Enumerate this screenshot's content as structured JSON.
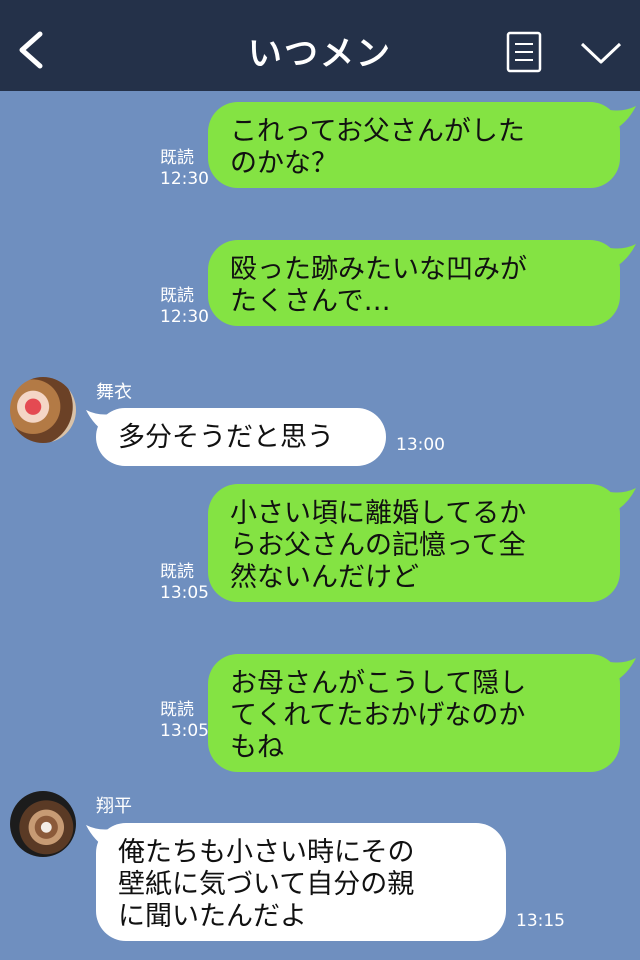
{
  "header": {
    "title": "いつメン"
  },
  "messages": [
    {
      "from": "me",
      "text": "これってお父さんがした\nのかな？",
      "read": "既読",
      "time": "12:30"
    },
    {
      "from": "me",
      "text": "殴った跡みたいな凹みが\nたくさんで…",
      "read": "既読",
      "time": "12:30"
    },
    {
      "from": "other",
      "sender": "舞衣",
      "text": "多分そうだと思う",
      "time": "13:00"
    },
    {
      "from": "me",
      "text": "小さい頃に離婚してるか\nらお父さんの記憶って全\n然ないんだけど",
      "read": "既読",
      "time": "13:05"
    },
    {
      "from": "me",
      "text": "お母さんがこうして隠し\nてくれてたおかげなのか\nもね",
      "read": "既読",
      "time": "13:05"
    },
    {
      "from": "other",
      "sender": "翔平",
      "text": "俺たちも小さい時にその\n壁紙に気づいて自分の親\nに聞いたんだよ",
      "time": "13:15"
    }
  ],
  "colors": {
    "background": "#6f8fbf",
    "header": "#243149",
    "me_bubble": "#84e343",
    "other_bubble": "#ffffff"
  }
}
